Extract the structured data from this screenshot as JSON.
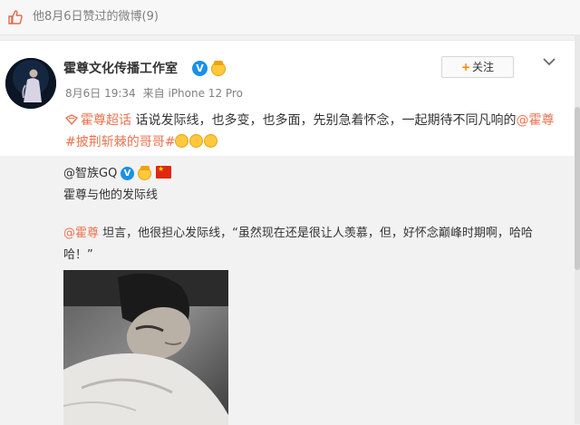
{
  "topbar": {
    "like_icon": "thumbs-up-icon",
    "text": "他8月6日赞过的微博(9)"
  },
  "post": {
    "author": "霍尊文化传播工作室",
    "verified_icon": "v-badge-icon",
    "follow_label": "关注",
    "follow_icon": "plus-icon",
    "menu_icon": "chevron-down-icon",
    "date": "8月6日 19:34",
    "source": "来自 iPhone 12 Pro",
    "topic_link": "霍尊超话",
    "text_part1": " 话说发际线，也多变，也多面，先别急着怀念，一起期待不同凡响的",
    "mention": "@霍尊",
    "hashtag": "#披荆斩棘的哥哥#"
  },
  "repost": {
    "author": "@智族GQ",
    "verified_icon": "v-badge-icon",
    "flag_icon": "china-flag-icon",
    "caption": "霍尊与他的发际线",
    "mention": "@霍尊",
    "quote": " 坦言，他很担心发际线，“虽然现在还是很让人羡慕，但，好怀念巅峰时期啊，哈哈哈！”"
  },
  "colors": {
    "link": "#eb7350",
    "verified": "#1990e8",
    "follow_plus": "#ff8200"
  }
}
